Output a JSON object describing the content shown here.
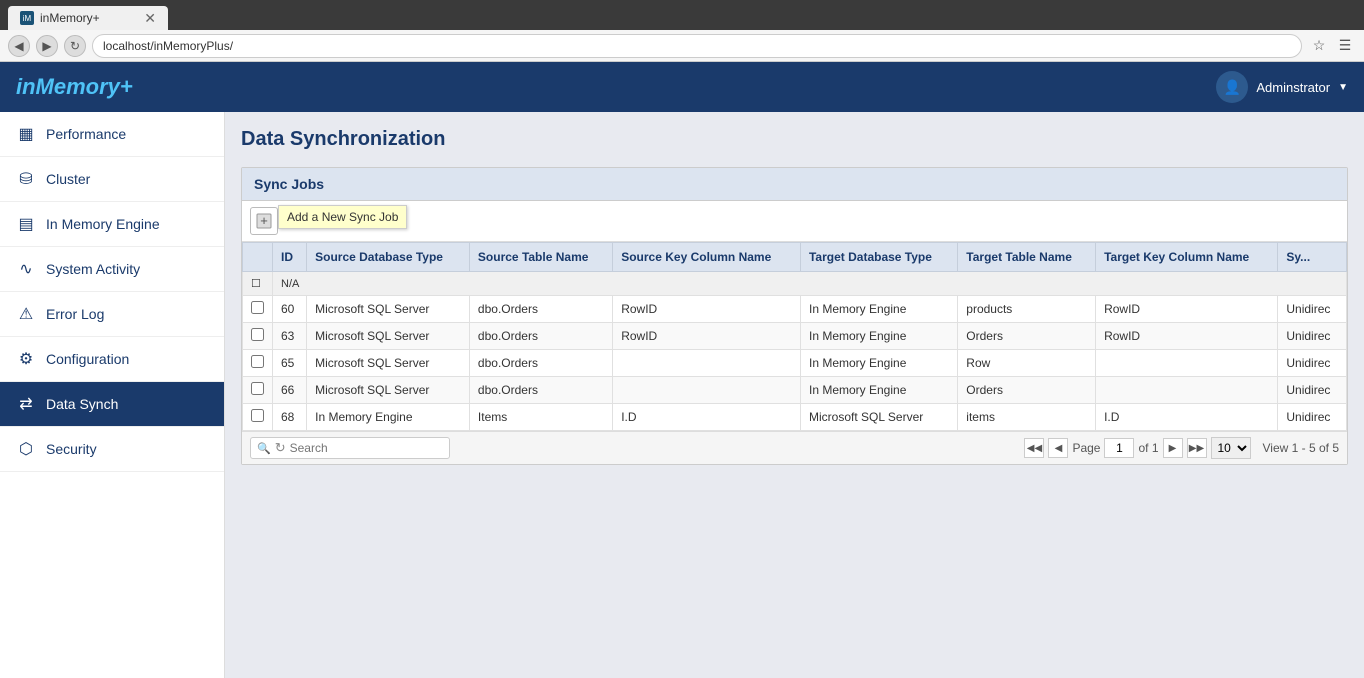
{
  "browser": {
    "tab_title": "inMemory+",
    "url": "localhost/inMemoryPlus/",
    "back_btn": "◀",
    "forward_btn": "▶",
    "refresh_btn": "↻"
  },
  "app": {
    "logo": "inMemory+",
    "admin_label": "Adminstrator",
    "header_title": "Data Synchronization"
  },
  "sidebar": {
    "items": [
      {
        "id": "performance",
        "label": "Performance",
        "icon": "▦"
      },
      {
        "id": "cluster",
        "label": "Cluster",
        "icon": "⛁"
      },
      {
        "id": "in-memory-engine",
        "label": "In Memory Engine",
        "icon": "▤"
      },
      {
        "id": "system-activity",
        "label": "System Activity",
        "icon": "∿"
      },
      {
        "id": "error-log",
        "label": "Error Log",
        "icon": "⚠"
      },
      {
        "id": "configuration",
        "label": "Configuration",
        "icon": "⚙"
      },
      {
        "id": "data-synch",
        "label": "Data Synch",
        "icon": "⇄"
      },
      {
        "id": "security",
        "label": "Security",
        "icon": "⬡"
      }
    ]
  },
  "panel": {
    "title": "Sync Jobs",
    "add_tooltip": "Add a New Sync Job"
  },
  "table": {
    "columns": [
      "",
      "ID",
      "Source Database Type",
      "Source Table Name",
      "Source Key Column Name",
      "Target Database Type",
      "Target Table Name",
      "Target Key Column Name",
      "Sy..."
    ],
    "na_row": "N/A",
    "rows": [
      {
        "id": "60",
        "source_db": "Microsoft SQL Server",
        "source_table": "dbo.Orders",
        "source_key": "RowID",
        "target_db": "In Memory Engine",
        "target_table": "products",
        "target_key": "RowID",
        "sync": "Unidirec"
      },
      {
        "id": "63",
        "source_db": "Microsoft SQL Server",
        "source_table": "dbo.Orders",
        "source_key": "RowID",
        "target_db": "In Memory Engine",
        "target_table": "Orders",
        "target_key": "RowID",
        "sync": "Unidirec"
      },
      {
        "id": "65",
        "source_db": "Microsoft SQL Server",
        "source_table": "dbo.Orders",
        "source_key": "",
        "target_db": "In Memory Engine",
        "target_table": "Row",
        "target_key": "",
        "sync": "Unidirec"
      },
      {
        "id": "66",
        "source_db": "Microsoft SQL Server",
        "source_table": "dbo.Orders",
        "source_key": "",
        "target_db": "In Memory Engine",
        "target_table": "Orders",
        "target_key": "",
        "sync": "Unidirec"
      },
      {
        "id": "68",
        "source_db": "In Memory Engine",
        "source_table": "Items",
        "source_key": "I.D",
        "target_db": "Microsoft SQL Server",
        "target_table": "items",
        "target_key": "I.D",
        "sync": "Unidirec"
      }
    ]
  },
  "pagination": {
    "search_placeholder": "Search",
    "page_label": "Page",
    "current_page": "1",
    "of_label": "of 1",
    "rows_per_page": "10",
    "view_count": "View 1 - 5 of 5",
    "first_btn": "◀◀",
    "prev_btn": "◀",
    "next_btn": "▶",
    "last_btn": "▶▶"
  }
}
